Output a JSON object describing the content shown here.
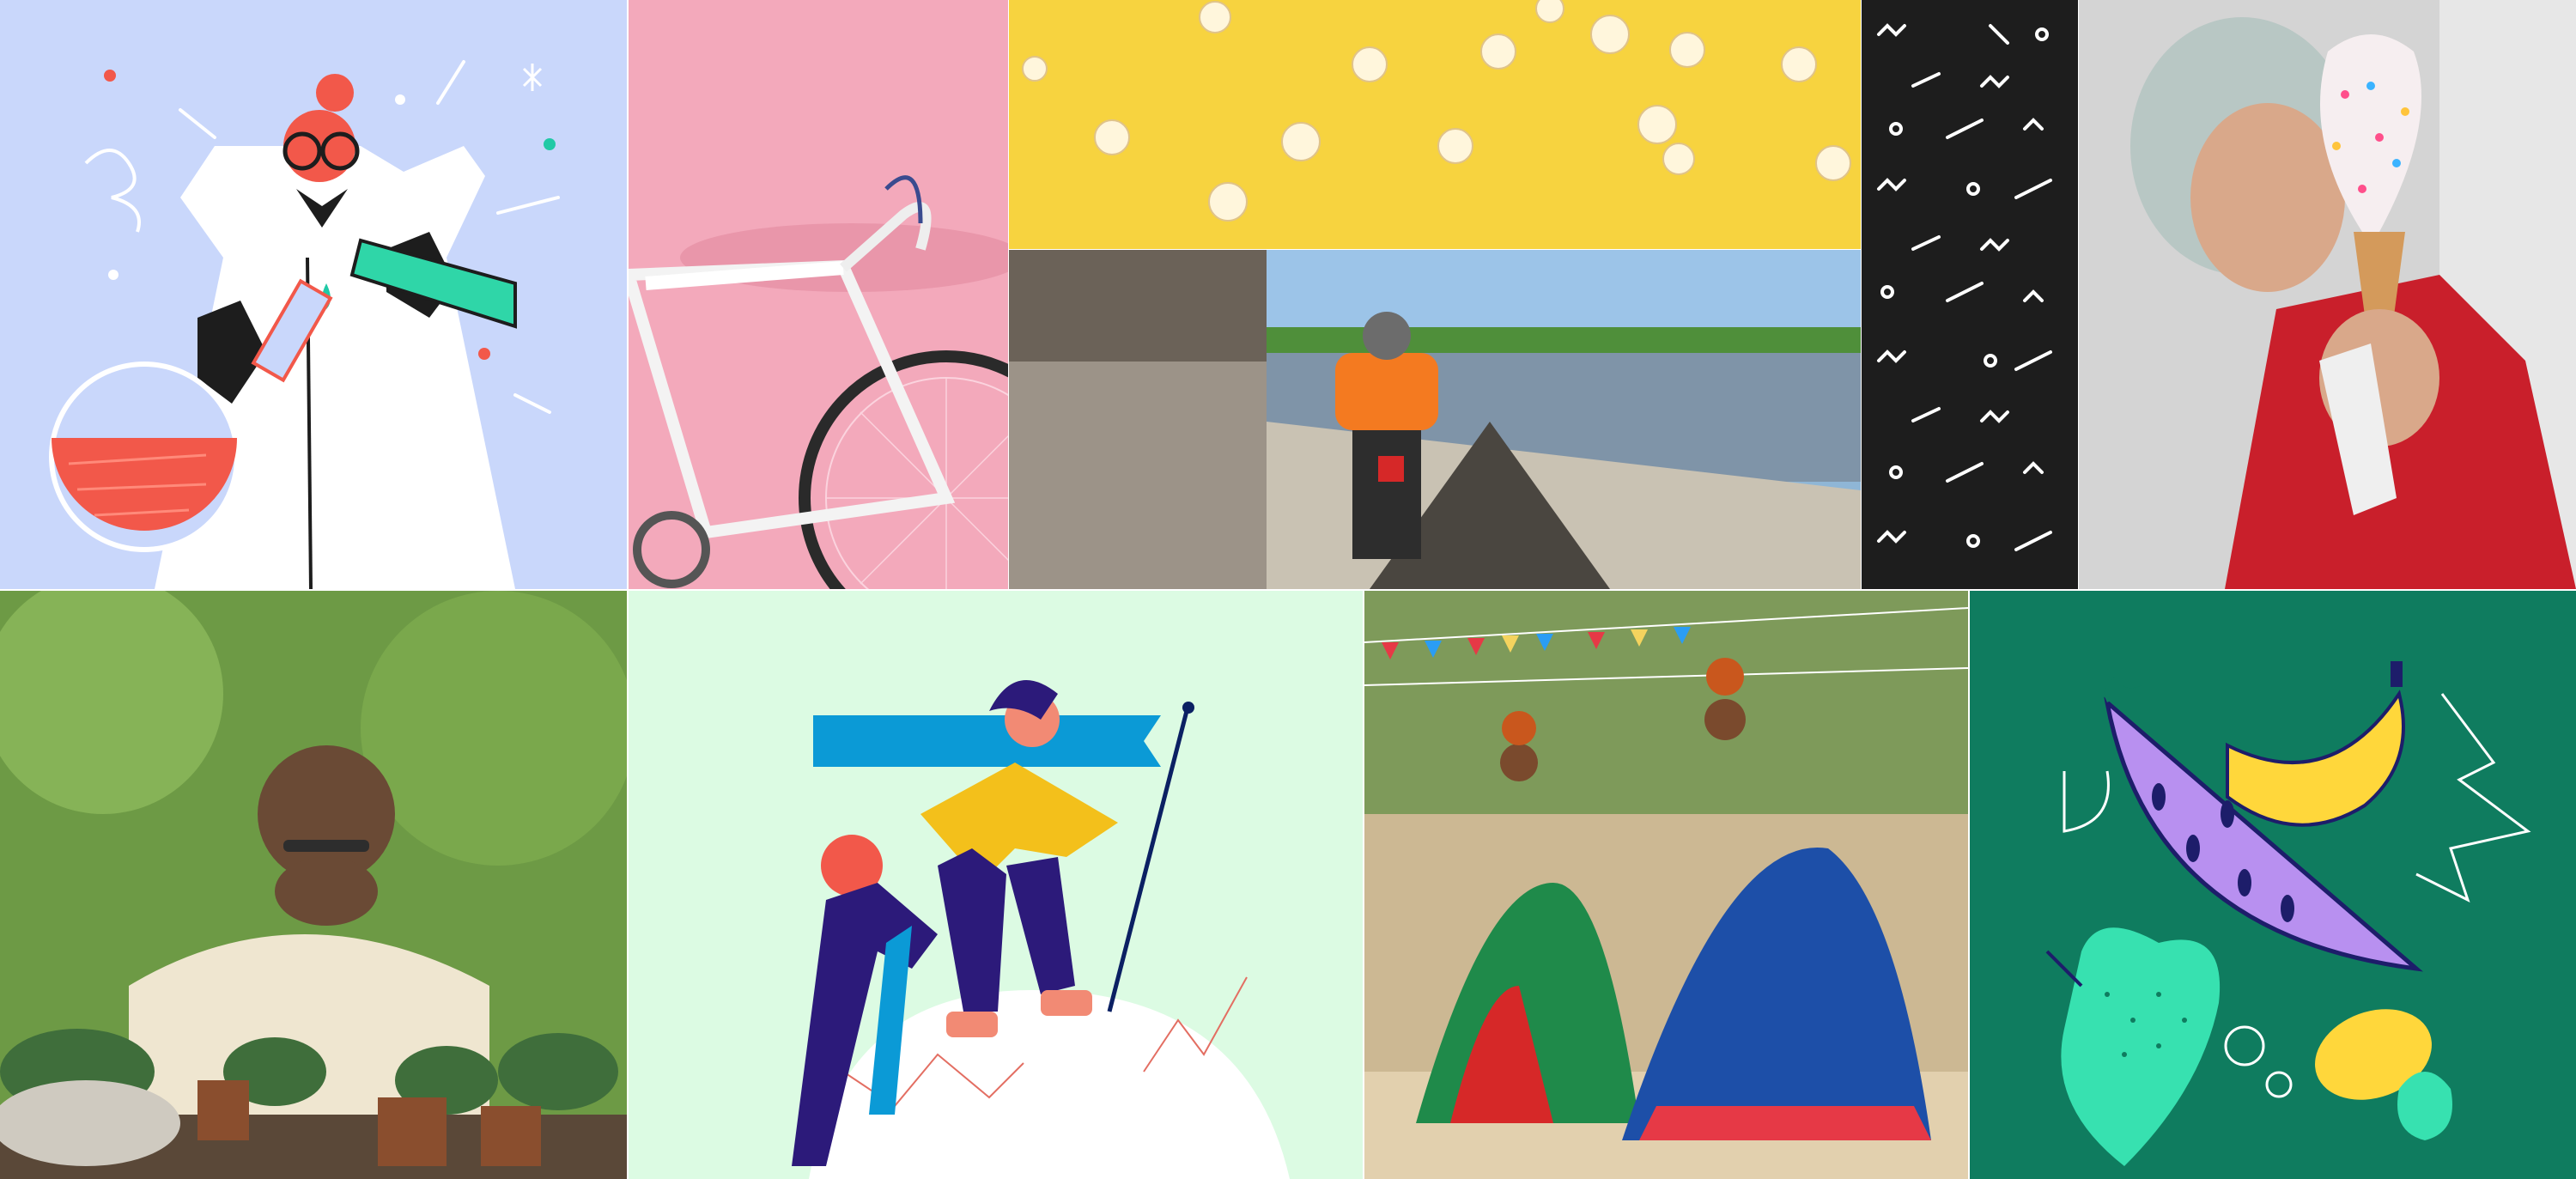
{
  "tiles": [
    {
      "id": "scientist",
      "kind": "illustration",
      "background": "#c9d7fb",
      "accent": "#f2584a"
    },
    {
      "id": "bicycle",
      "kind": "photo",
      "background": "#f2a6b8"
    },
    {
      "id": "popcorn",
      "kind": "photo",
      "background": "#f7d33f"
    },
    {
      "id": "motorbike-promenade",
      "kind": "photo",
      "background": "#8fb6d6"
    },
    {
      "id": "squiggle-pattern",
      "kind": "pattern",
      "background": "#1d1d1d"
    },
    {
      "id": "ice-cream-cone",
      "kind": "photo",
      "background": "#d9d9d9"
    },
    {
      "id": "gardener",
      "kind": "photo",
      "background": "#5f8a3c"
    },
    {
      "id": "hikers-summit",
      "kind": "illustration",
      "background": "#dcfbe3",
      "accent": "#0b9ad6"
    },
    {
      "id": "folk-dancers",
      "kind": "photo",
      "background": "#d8c9a9"
    },
    {
      "id": "fruit-shapes",
      "kind": "illustration",
      "background": "#0f7c5f",
      "accent": "#b890f0"
    }
  ]
}
